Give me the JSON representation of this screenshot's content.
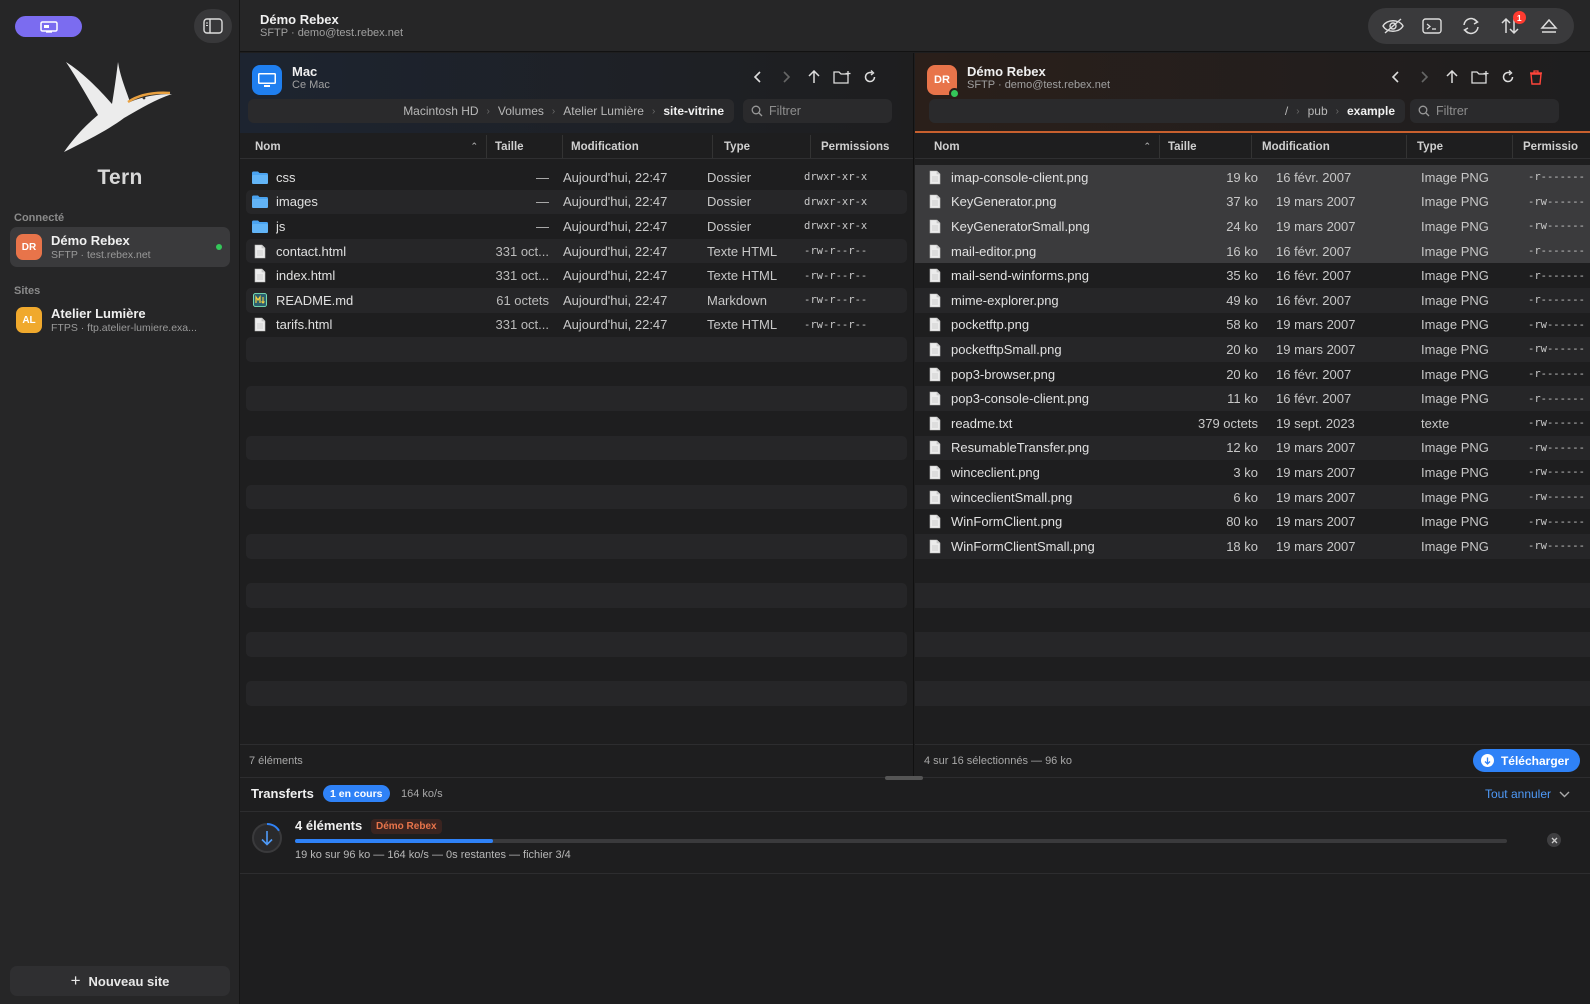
{
  "sidebar": {
    "app_name": "Tern",
    "connected_label": "Connecté",
    "sites_label": "Sites",
    "connected": {
      "initials": "DR",
      "name": "Démo Rebex",
      "sub": "SFTP · test.rebex.net",
      "color": "#e8744a"
    },
    "sites": [
      {
        "initials": "AL",
        "name": "Atelier Lumière",
        "sub": "FTPS · ftp.atelier-lumiere.exa...",
        "color": "#f0a92d"
      }
    ],
    "new_site_label": "Nouveau site"
  },
  "titlebar": {
    "title": "Démo Rebex",
    "subtitle": "SFTP · demo@test.rebex.net",
    "badge_count": "1"
  },
  "left_pane": {
    "title": "Mac",
    "subtitle": "Ce Mac",
    "breadcrumbs": [
      "Macintosh HD",
      "Volumes",
      "Atelier Lumière",
      "site-vitrine"
    ],
    "filter_placeholder": "Filtrer",
    "columns": [
      "Nom",
      "Taille",
      "Modification",
      "Type",
      "Permissions"
    ],
    "rows": [
      {
        "kind": "folder",
        "name": "css",
        "size": "—",
        "modified": "Aujourd'hui, 22:47",
        "type": "Dossier",
        "perms": "drwxr-xr-x"
      },
      {
        "kind": "folder",
        "name": "images",
        "size": "—",
        "modified": "Aujourd'hui, 22:47",
        "type": "Dossier",
        "perms": "drwxr-xr-x"
      },
      {
        "kind": "folder",
        "name": "js",
        "size": "—",
        "modified": "Aujourd'hui, 22:47",
        "type": "Dossier",
        "perms": "drwxr-xr-x"
      },
      {
        "kind": "file",
        "name": "contact.html",
        "size": "331 oct...",
        "modified": "Aujourd'hui, 22:47",
        "type": "Texte HTML",
        "perms": "-rw-r--r--"
      },
      {
        "kind": "file",
        "name": "index.html",
        "size": "331 oct...",
        "modified": "Aujourd'hui, 22:47",
        "type": "Texte HTML",
        "perms": "-rw-r--r--"
      },
      {
        "kind": "md",
        "name": "README.md",
        "size": "61 octets",
        "modified": "Aujourd'hui, 22:47",
        "type": "Markdown",
        "perms": "-rw-r--r--"
      },
      {
        "kind": "file",
        "name": "tarifs.html",
        "size": "331 oct...",
        "modified": "Aujourd'hui, 22:47",
        "type": "Texte HTML",
        "perms": "-rw-r--r--"
      }
    ],
    "footer": "7 éléments"
  },
  "right_pane": {
    "initials": "DR",
    "title": "Démo Rebex",
    "subtitle": "SFTP · demo@test.rebex.net",
    "breadcrumbs": [
      "/",
      "pub",
      "example"
    ],
    "filter_placeholder": "Filtrer",
    "columns": [
      "Nom",
      "Taille",
      "Modification",
      "Type",
      "Permissio"
    ],
    "rows": [
      {
        "name": "imap-console-client.png",
        "size": "19 ko",
        "modified": "16 févr. 2007",
        "type": "Image PNG",
        "perms": "-r-------",
        "selected": true
      },
      {
        "name": "KeyGenerator.png",
        "size": "37 ko",
        "modified": "19 mars 2007",
        "type": "Image PNG",
        "perms": "-rw------",
        "selected": true
      },
      {
        "name": "KeyGeneratorSmall.png",
        "size": "24 ko",
        "modified": "19 mars 2007",
        "type": "Image PNG",
        "perms": "-rw------",
        "selected": true
      },
      {
        "name": "mail-editor.png",
        "size": "16 ko",
        "modified": "16 févr. 2007",
        "type": "Image PNG",
        "perms": "-r-------",
        "selected": true
      },
      {
        "name": "mail-send-winforms.png",
        "size": "35 ko",
        "modified": "16 févr. 2007",
        "type": "Image PNG",
        "perms": "-r-------",
        "selected": false
      },
      {
        "name": "mime-explorer.png",
        "size": "49 ko",
        "modified": "16 févr. 2007",
        "type": "Image PNG",
        "perms": "-r-------",
        "selected": false
      },
      {
        "name": "pocketftp.png",
        "size": "58 ko",
        "modified": "19 mars 2007",
        "type": "Image PNG",
        "perms": "-rw------",
        "selected": false
      },
      {
        "name": "pocketftpSmall.png",
        "size": "20 ko",
        "modified": "19 mars 2007",
        "type": "Image PNG",
        "perms": "-rw------",
        "selected": false
      },
      {
        "name": "pop3-browser.png",
        "size": "20 ko",
        "modified": "16 févr. 2007",
        "type": "Image PNG",
        "perms": "-r-------",
        "selected": false
      },
      {
        "name": "pop3-console-client.png",
        "size": "11 ko",
        "modified": "16 févr. 2007",
        "type": "Image PNG",
        "perms": "-r-------",
        "selected": false
      },
      {
        "name": "readme.txt",
        "size": "379 octets",
        "modified": "19 sept. 2023",
        "type": "texte",
        "perms": "-rw------",
        "selected": false
      },
      {
        "name": "ResumableTransfer.png",
        "size": "12 ko",
        "modified": "19 mars 2007",
        "type": "Image PNG",
        "perms": "-rw------",
        "selected": false
      },
      {
        "name": "winceclient.png",
        "size": "3 ko",
        "modified": "19 mars 2007",
        "type": "Image PNG",
        "perms": "-rw------",
        "selected": false
      },
      {
        "name": "winceclientSmall.png",
        "size": "6 ko",
        "modified": "19 mars 2007",
        "type": "Image PNG",
        "perms": "-rw------",
        "selected": false
      },
      {
        "name": "WinFormClient.png",
        "size": "80 ko",
        "modified": "19 mars 2007",
        "type": "Image PNG",
        "perms": "-rw------",
        "selected": false
      },
      {
        "name": "WinFormClientSmall.png",
        "size": "18 ko",
        "modified": "19 mars 2007",
        "type": "Image PNG",
        "perms": "-rw------",
        "selected": false
      }
    ],
    "footer": "4 sur 16 sélectionnés — 96 ko",
    "download_label": "Télécharger"
  },
  "transfers": {
    "title": "Transferts",
    "badge": "1 en cours",
    "speed": "164 ko/s",
    "cancel_all": "Tout annuler",
    "item": {
      "name": "4 éléments",
      "tag": "Démo Rebex",
      "progress_fraction": 0.163,
      "detail": "19 ko sur 96 ko — 164 ko/s — 0s restantes — fichier 3/4"
    }
  },
  "colors": {
    "accent": "#2f82f7",
    "remote": "#e8744a",
    "online": "#34c759"
  }
}
